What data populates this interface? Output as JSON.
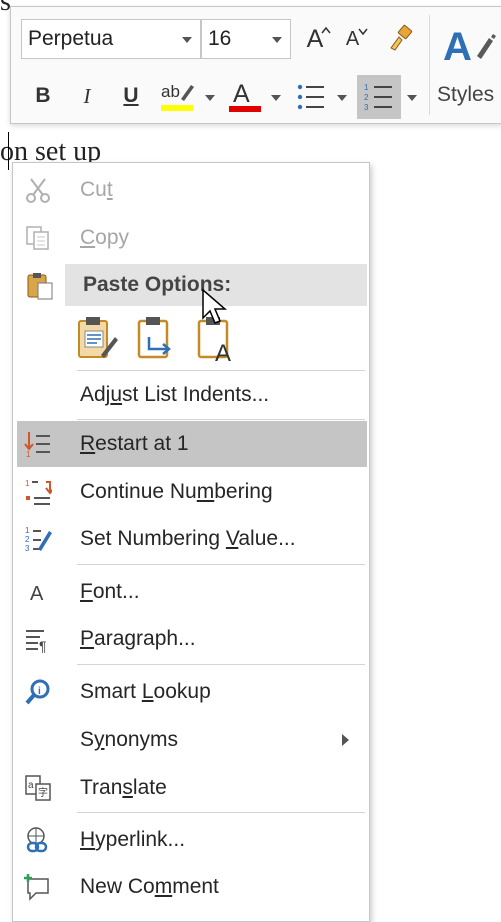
{
  "document": {
    "line_text": "on set up",
    "line_prefix": "s"
  },
  "toolbar": {
    "font_name": "Perpetua",
    "font_size": "16",
    "grow_font": "A",
    "shrink_font": "A",
    "bold": "B",
    "italic": "I",
    "underline": "U",
    "highlight_glyph": "ab",
    "font_color_glyph": "A",
    "styles_label": "Styles",
    "highlight_color": "#ffff00",
    "font_color": "#e00000"
  },
  "menu": {
    "cut": {
      "pre": "Cu",
      "u": "t",
      "post": ""
    },
    "copy": {
      "pre": "",
      "u": "C",
      "post": "opy"
    },
    "paste_options": "Paste Options:",
    "adjust": {
      "pre": "Adj",
      "u": "u",
      "post": "st List Indents..."
    },
    "restart": {
      "pre": "",
      "u": "R",
      "post": "estart at 1"
    },
    "continue": {
      "pre": "Continue Nu",
      "u": "m",
      "post": "bering"
    },
    "set_value": {
      "pre": "Set Numbering ",
      "u": "V",
      "post": "alue..."
    },
    "font": {
      "pre": "",
      "u": "F",
      "post": "ont..."
    },
    "paragraph": {
      "pre": "",
      "u": "P",
      "post": "aragraph..."
    },
    "smart_lookup": {
      "pre": "Smart ",
      "u": "L",
      "post": "ookup"
    },
    "synonyms": {
      "pre": "S",
      "u": "y",
      "post": "nonyms"
    },
    "translate": {
      "pre": "Tran",
      "u": "s",
      "post": "late"
    },
    "hyperlink": {
      "pre": "",
      "u": "H",
      "post": "yperlink..."
    },
    "new_comment": {
      "pre": "New Co",
      "u": "m",
      "post": "ment"
    }
  }
}
